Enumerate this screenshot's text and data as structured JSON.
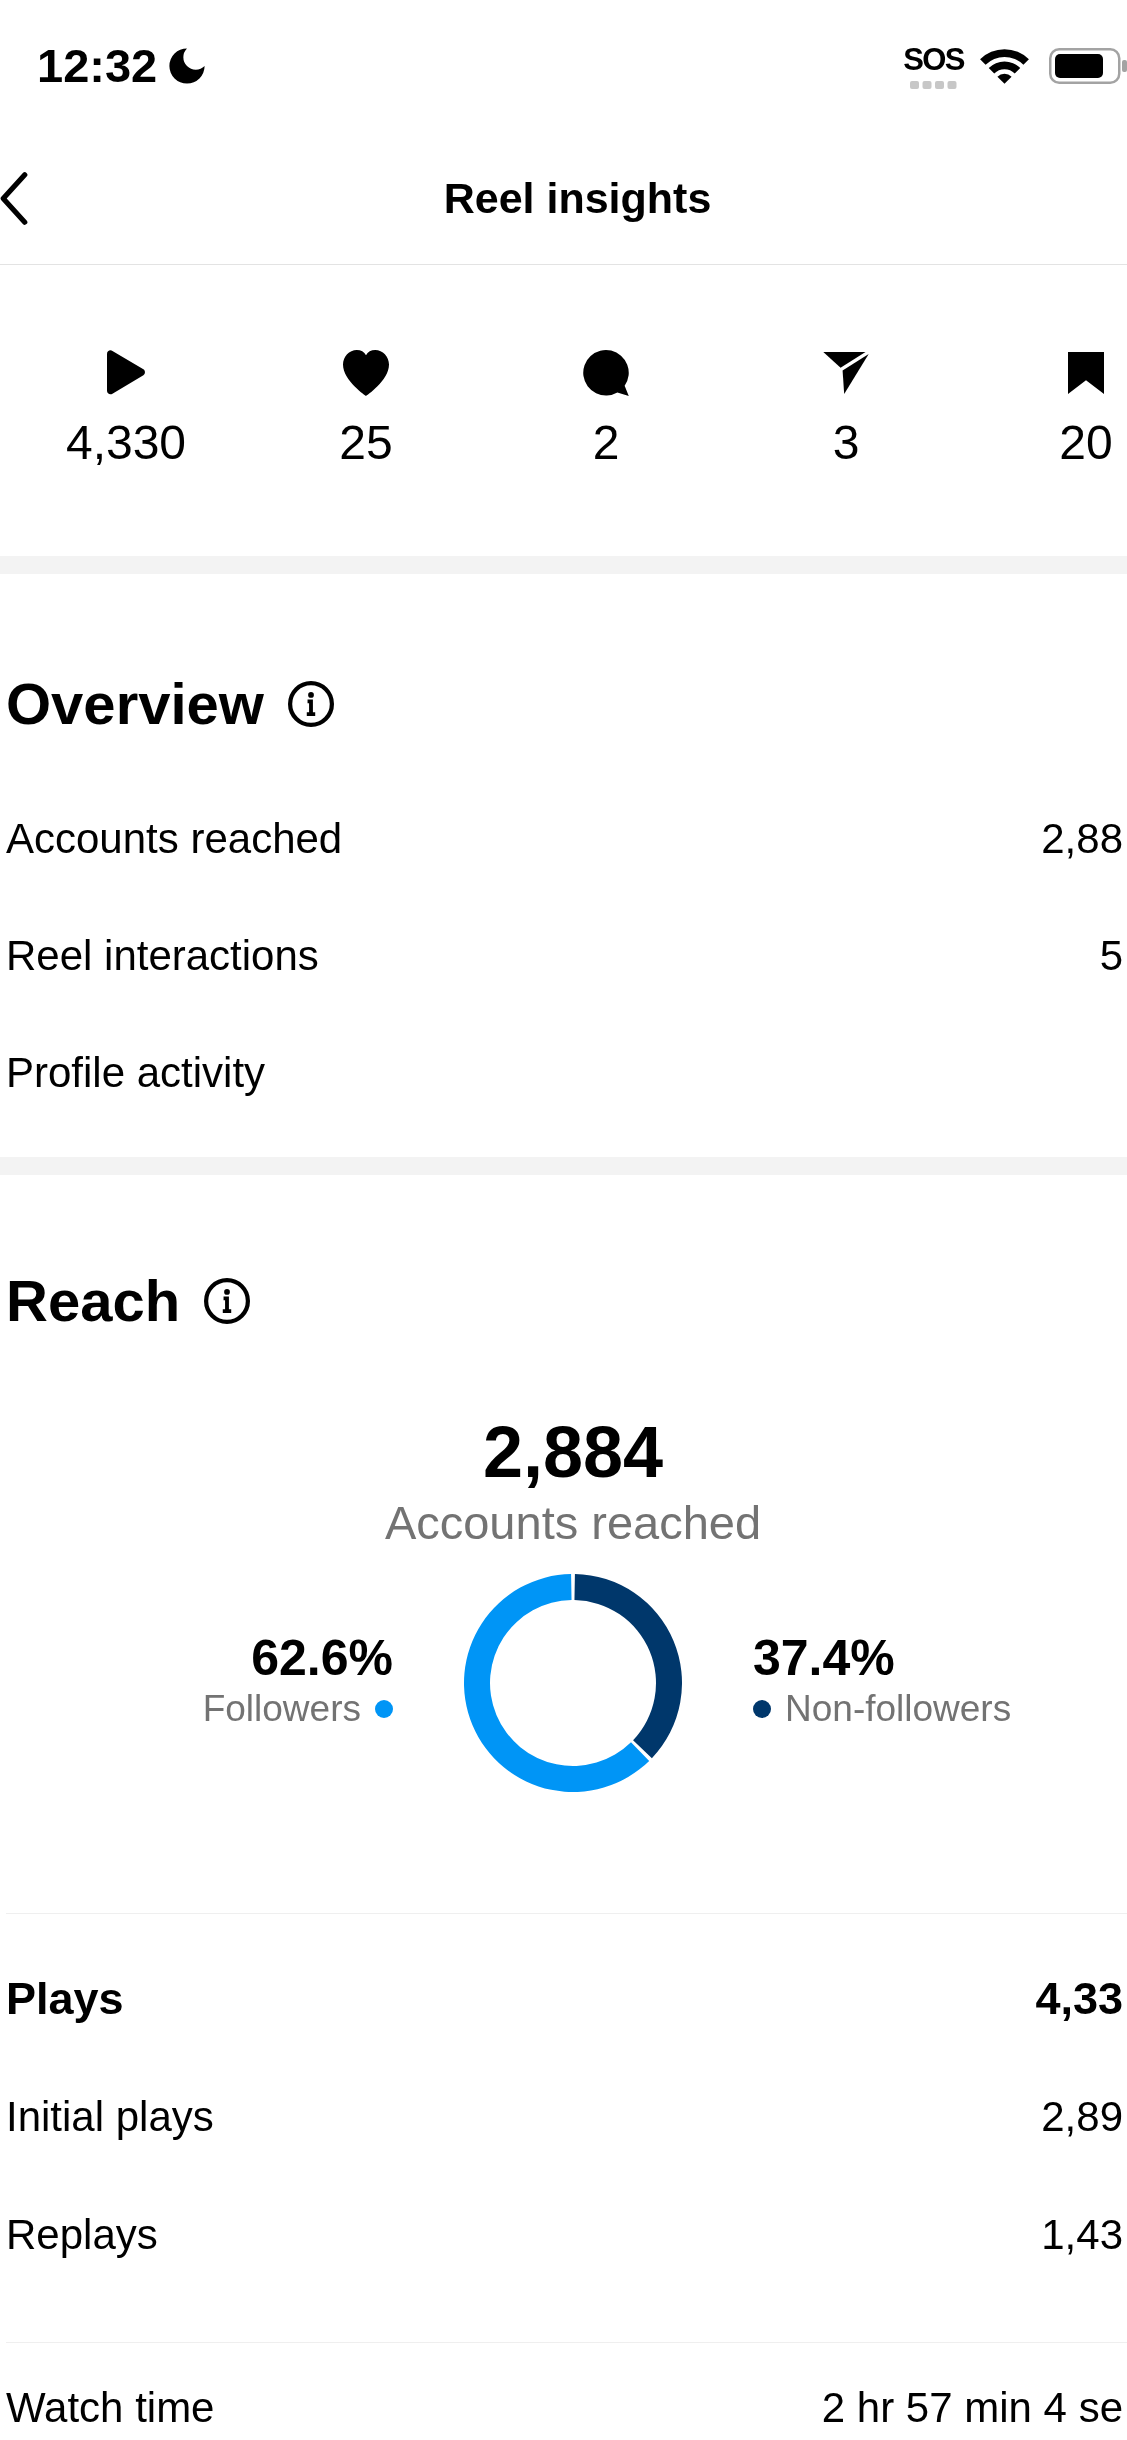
{
  "status_bar": {
    "time": "12:32",
    "sos": "SOS"
  },
  "header": {
    "title": "Reel insights"
  },
  "stats": [
    {
      "kind": "plays",
      "value": "4,330"
    },
    {
      "kind": "likes",
      "value": "25"
    },
    {
      "kind": "comments",
      "value": "2"
    },
    {
      "kind": "shares",
      "value": "3"
    },
    {
      "kind": "saves",
      "value": "20"
    }
  ],
  "overview": {
    "title": "Overview",
    "rows": [
      {
        "label": "Accounts reached",
        "value": "2,88"
      },
      {
        "label": "Reel interactions",
        "value": "5"
      },
      {
        "label": "Profile activity"
      }
    ]
  },
  "reach": {
    "title": "Reach",
    "total": "2,884",
    "total_label": "Accounts reached",
    "chart_data": {
      "type": "donut",
      "categories": [
        "Followers",
        "Non-followers"
      ],
      "values": [
        62.6,
        37.4
      ]
    },
    "legend": [
      {
        "value": "62.6%",
        "color": "#0095f6"
      },
      {
        "value": "37.4%",
        "color": "#00376b"
      }
    ]
  },
  "plays": {
    "label": "Plays",
    "value": "4,33",
    "rows": [
      {
        "label": "Initial plays",
        "value": "2,89"
      },
      {
        "label": "Replays",
        "value": "1,43"
      }
    ]
  },
  "watch_time": {
    "label": "Watch time",
    "value": "2 hr 57 min 4 se"
  }
}
